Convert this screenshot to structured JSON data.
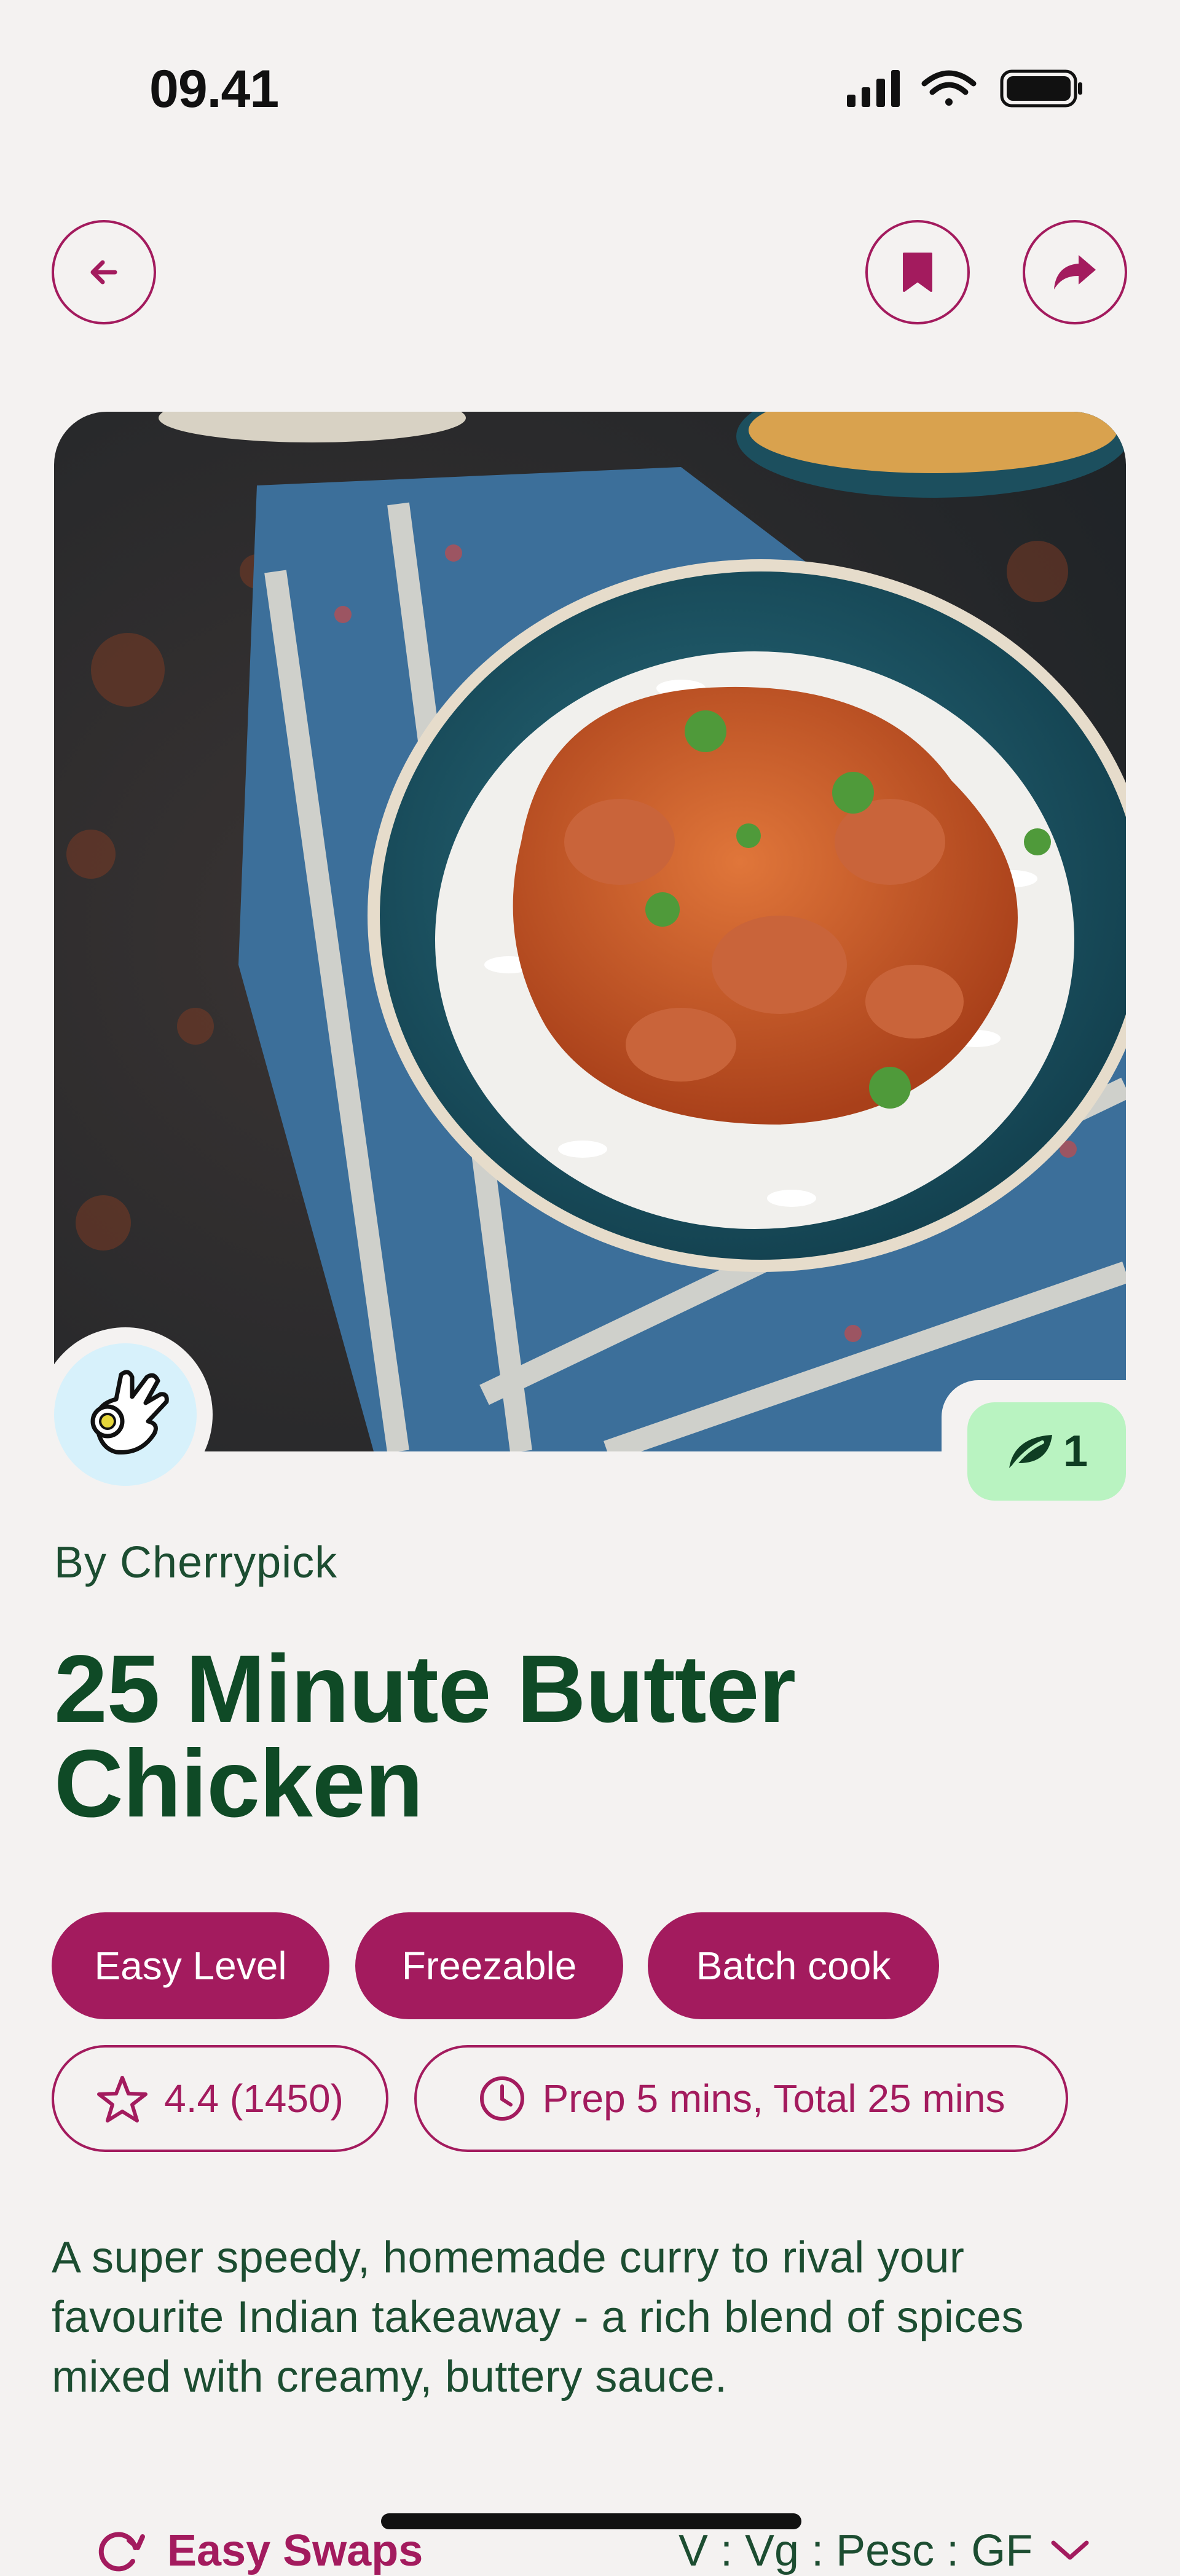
{
  "status_bar": {
    "time": "09.41",
    "icons": [
      "signal-icon",
      "wifi-icon",
      "battery-icon"
    ]
  },
  "nav": {
    "icons": [
      "arrow-left-icon",
      "bookmark-icon",
      "share-arrow-icon"
    ]
  },
  "recipe": {
    "author": "By Cherrypick",
    "title": "25 Minute Butter Chicken",
    "eco_score": "1",
    "tags": [
      "Easy Level",
      "Freezable",
      "Batch cook"
    ],
    "rating": "4.4 (1450)",
    "time": "Prep 5 mins, Total 25 mins",
    "description": "A super speedy, homemade curry to rival your favourite Indian takeaway - a rich blend of spices mixed with creamy, buttery sauce."
  },
  "swaps": {
    "title": "Easy Swaps",
    "diet_tags": "V : Vg : Pesc : GF"
  },
  "colors": {
    "accent": "#a31b5e",
    "primary_text": "#0f4a26",
    "background": "#f4f2f1",
    "eco_badge": "#b9f3c1",
    "avatar_bg": "#d7f1fb"
  }
}
